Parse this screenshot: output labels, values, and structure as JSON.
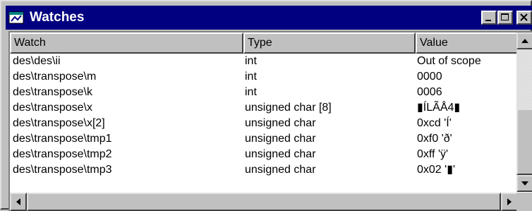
{
  "window": {
    "title": "Watches"
  },
  "columns": {
    "watch": "Watch",
    "type": "Type",
    "value": "Value"
  },
  "rows": [
    {
      "watch": "des\\des\\ii",
      "type": "int",
      "value": "Out of scope"
    },
    {
      "watch": "des\\transpose\\m",
      "type": "int",
      "value": "0000"
    },
    {
      "watch": "des\\transpose\\k",
      "type": "int",
      "value": "0006"
    },
    {
      "watch": "des\\transpose\\x",
      "type": "unsigned char [8]",
      "value": "▮ÍLÃÅ4▮"
    },
    {
      "watch": "des\\transpose\\x[2]",
      "type": "unsigned char",
      "value": "0xcd  'Í'"
    },
    {
      "watch": "des\\transpose\\tmp1",
      "type": "unsigned char",
      "value": "0xf0  'ð'"
    },
    {
      "watch": "des\\transpose\\tmp2",
      "type": "unsigned char",
      "value": "0xff  'ÿ'"
    },
    {
      "watch": "des\\transpose\\tmp3",
      "type": "unsigned char",
      "value": "0x02  '▮'"
    }
  ],
  "icons": {
    "window": "watch-window-icon",
    "minimize": "minimize-icon",
    "maximize": "maximize-icon",
    "close": "close-icon"
  },
  "colors": {
    "titlebar": "#000080",
    "face": "#c0c0c0"
  }
}
